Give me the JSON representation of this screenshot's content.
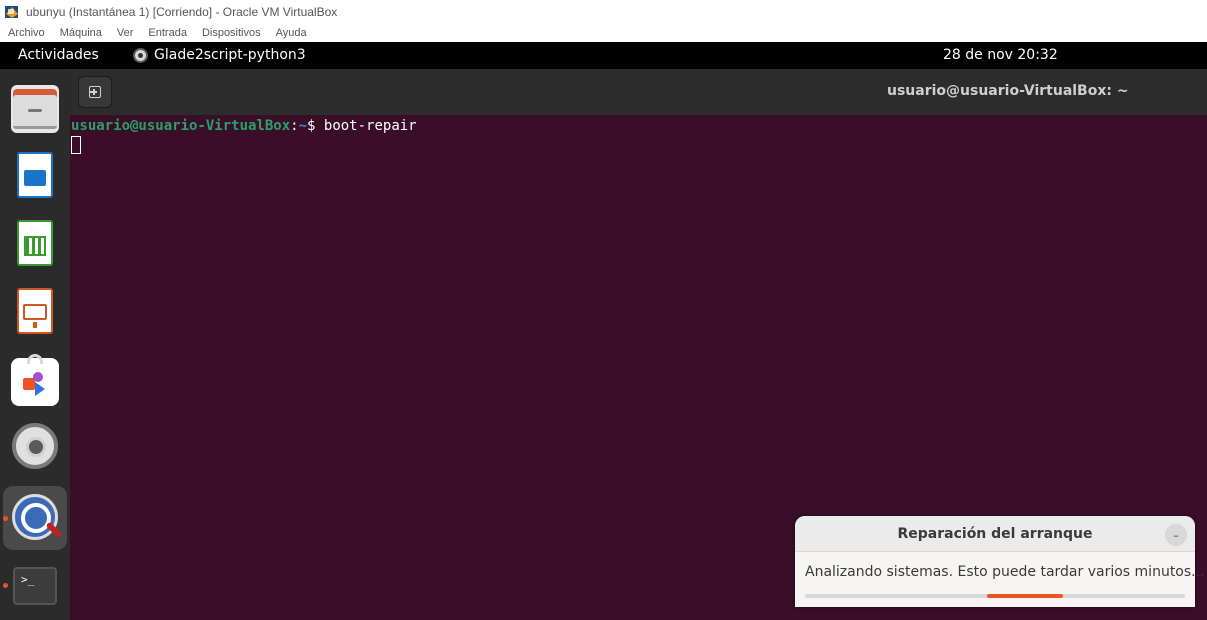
{
  "vbox": {
    "window_title": "ubunyu (Instantánea 1) [Corriendo] - Oracle VM VirtualBox",
    "menu": [
      "Archivo",
      "Máquina",
      "Ver",
      "Entrada",
      "Dispositivos",
      "Ayuda"
    ]
  },
  "topbar": {
    "activities": "Actividades",
    "app_name": "Glade2script-python3",
    "clock": "28 de nov  20:32"
  },
  "dock": {
    "items": [
      "files-icon",
      "libreoffice-writer-icon",
      "libreoffice-calc-icon",
      "libreoffice-impress-icon",
      "app-center-icon",
      "settings-icon",
      "boot-repair-icon",
      "terminal-icon"
    ],
    "terminal_glyph": ">_"
  },
  "terminal": {
    "title": "usuario@usuario-VirtualBox: ~",
    "prompt_user_host": "usuario@usuario-VirtualBox",
    "prompt_colon": ":",
    "prompt_path": "~",
    "prompt_symbol": "$ ",
    "command": "boot-repair"
  },
  "dialog": {
    "title": "Reparación del arranque",
    "minimize_label": "–",
    "message": "Analizando sistemas. Esto puede tardar varios minutos...",
    "progress": {
      "start": 0.48,
      "end": 0.68
    }
  },
  "colors": {
    "accent": "#e95420",
    "terminal_bg": "#3a0d29",
    "prompt_green": "#26a269",
    "prompt_blue": "#4d7fc9"
  }
}
